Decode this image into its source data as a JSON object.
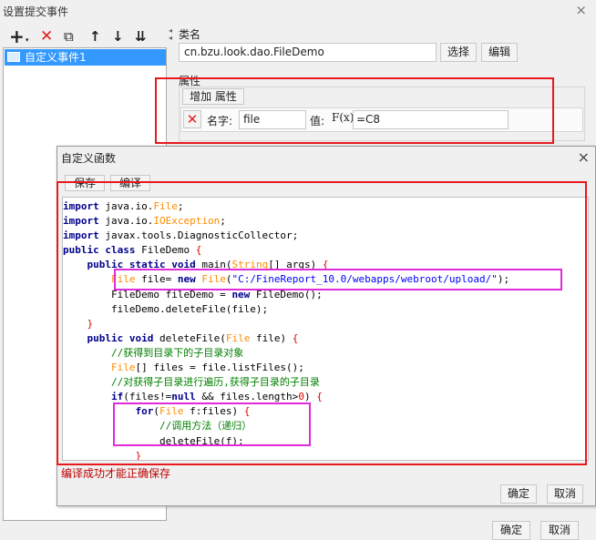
{
  "outer_window": {
    "title": "设置提交事件",
    "close": "×"
  },
  "toolbar": {
    "add": "+",
    "add_menu": "▾",
    "delete": "✕",
    "copy": "⧉",
    "move_up": "↑",
    "move_down": "↓",
    "move_bottom": "⇊"
  },
  "tree": {
    "items": [
      {
        "label": "自定义事件1"
      }
    ]
  },
  "class_section": {
    "label": "类名",
    "value": "cn.bzu.look.dao.FileDemo",
    "select_button": "选择",
    "edit_button": "编辑"
  },
  "attributes": {
    "label": "属性",
    "add_button": "增加 属性",
    "row": {
      "delete": "✕",
      "name_label": "名字:",
      "name_value": "file",
      "value_label": "值:",
      "fx_icon": "F(x)",
      "value_value": "=C8"
    }
  },
  "dialog": {
    "title": "自定义函数",
    "close": "×",
    "save_button": "保存",
    "compile_button": "编译",
    "code_lines": [
      "import java.io.File;",
      "import java.io.IOException;",
      "import javax.tools.DiagnosticCollector;",
      "public class FileDemo {",
      "    public static void main(String[] args) {",
      "        File file= new File(\"C:/FineReport_10.0/webapps/webroot/upload/\");",
      "        FileDemo fileDemo = new FileDemo();",
      "        fileDemo.deleteFile(file);",
      "    }",
      "    public void deleteFile(File file) {",
      "        //获得到目录下的子目录对象",
      "        File[] files = file.listFiles();",
      "        //对获得子目录进行遍历,获得子目录的子目录",
      "        if(files!=null && files.length>0) {",
      "            for(File f:files) {",
      "                //调用方法（递归）",
      "                deleteFile(f);",
      "            }"
    ],
    "hint": "编译成功才能正确保存",
    "ok_button": "确定",
    "cancel_button": "取消"
  },
  "footer": {
    "ok_button": "确定",
    "cancel_button": "取消"
  },
  "colors": {
    "highlight_red": "#e8191c",
    "highlight_pink": "#e02bd8",
    "selection": "#3399ff"
  }
}
